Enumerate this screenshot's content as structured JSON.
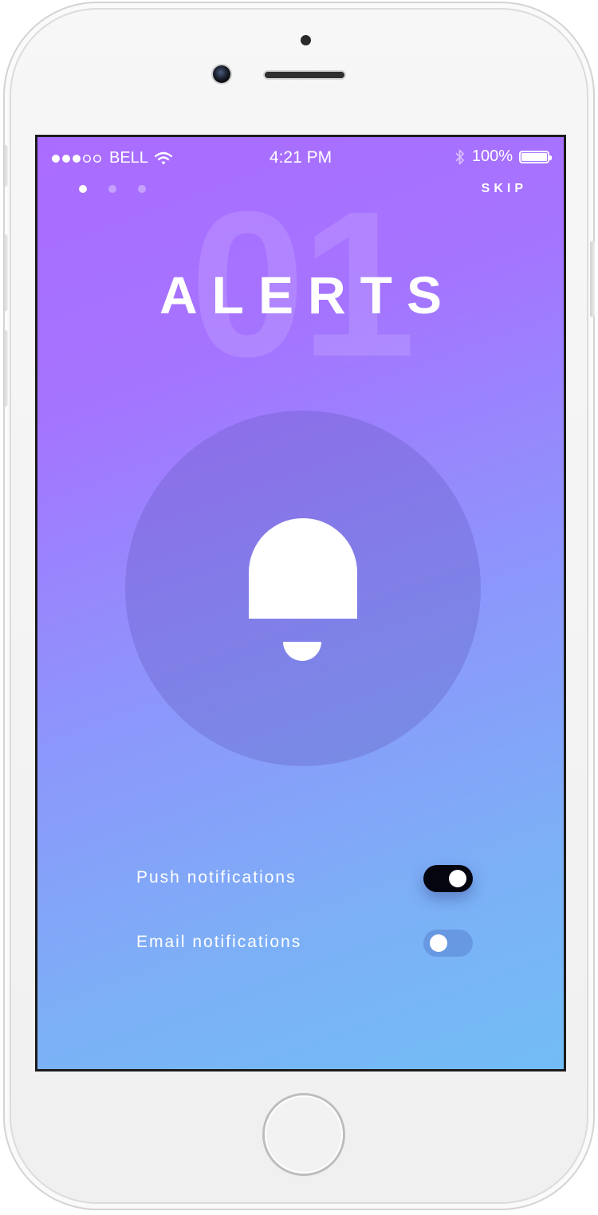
{
  "status_bar": {
    "carrier": "BELL",
    "time": "4:21 PM",
    "battery": "100%",
    "signal_bars_filled": 3,
    "signal_bars_total": 5,
    "battery_level": 1.0
  },
  "onboarding": {
    "skip_label": "SKIP",
    "page_index": 1,
    "page_count": 3,
    "step_number": "01",
    "title": "ALERTS",
    "icon": "bell-icon"
  },
  "settings": [
    {
      "label": "Push notifications",
      "enabled": true
    },
    {
      "label": "Email notifications",
      "enabled": false
    }
  ],
  "colors": {
    "gradient_start": "#aa6cff",
    "gradient_end": "#72bdf5",
    "toggle_on": "#050510"
  }
}
